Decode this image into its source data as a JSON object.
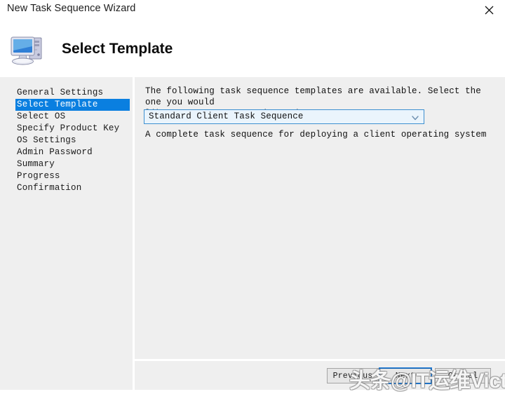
{
  "window": {
    "title": "New Task Sequence Wizard",
    "close_icon": "close-x-icon"
  },
  "header": {
    "icon": "computer-monitor-icon",
    "title": "Select Template"
  },
  "sidebar": {
    "items": [
      {
        "label": "General Settings",
        "active": false
      },
      {
        "label": "Select Template",
        "active": true
      },
      {
        "label": "Select OS",
        "active": false
      },
      {
        "label": "Specify Product Key",
        "active": false
      },
      {
        "label": "OS Settings",
        "active": false
      },
      {
        "label": "Admin Password",
        "active": false
      },
      {
        "label": "Summary",
        "active": false
      },
      {
        "label": "Progress",
        "active": false
      },
      {
        "label": "Confirmation",
        "active": false
      }
    ],
    "active_highlight_color": "#0a7fe0"
  },
  "content": {
    "intro_line1": "The following task sequence templates are available.  Select the one you would",
    "intro_line2": "like to use as a starting point.",
    "template_select": {
      "value": "Standard Client Task Sequence",
      "arrow_icon": "chevron-down-icon",
      "border_color": "#3d8fd0",
      "background_color": "#eaf4fc"
    },
    "description": "A complete task sequence for deploying a client operating system"
  },
  "footer": {
    "previous_label": "Previous",
    "next_label": "Next",
    "cancel_label": "Cancel",
    "focused_button": "Next",
    "focus_color": "#1464b4"
  },
  "watermark": {
    "text": "头条@IT运维Victor"
  }
}
